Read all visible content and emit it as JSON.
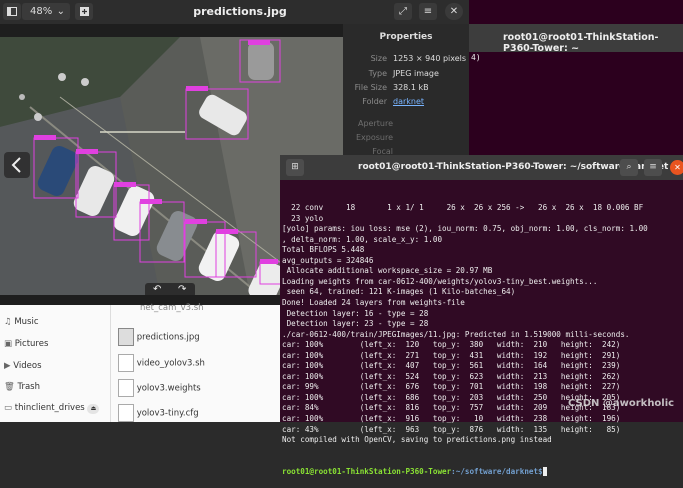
{
  "viewer": {
    "zoom": "48%",
    "title": "predictions.jpg",
    "properties": {
      "heading": "Properties",
      "size_label": "Size",
      "size_value": "1253 × 940 pixels",
      "type_label": "Type",
      "type_value": "JPEG image",
      "filesize_label": "File Size",
      "filesize_value": "328.1 kB",
      "folder_label": "Folder",
      "folder_value": "darknet",
      "aperture_label": "Aperture",
      "exposure_label": "Exposure",
      "focal_label": "Focal Length"
    },
    "detection_label": "car: 100%"
  },
  "bg_terminal": {
    "title": "root01@root01-ThinkStation-P360-Tower: ~",
    "fragment": "4)"
  },
  "files": {
    "sidebar": [
      {
        "label": "Music",
        "icon": "music-icon"
      },
      {
        "label": "Pictures",
        "icon": "pictures-icon"
      },
      {
        "label": "Videos",
        "icon": "videos-icon"
      },
      {
        "label": "Trash",
        "icon": "trash-icon"
      },
      {
        "label": "thinclient_drives",
        "icon": "drive-icon"
      }
    ],
    "items": [
      {
        "label": "net_cam_v3.sh"
      },
      {
        "label": "predictions.jpg"
      },
      {
        "label": "video_yolov3.sh"
      },
      {
        "label": "yolov3.weights"
      },
      {
        "label": "yolov3-tiny.cfg"
      }
    ]
  },
  "terminal": {
    "title": "root01@root01-ThinkStation-P360-Tower: ~/software/darknet",
    "lines": [
      "  22 conv     18       1 x 1/ 1     26 x  26 x 256 ->   26 x  26 x  18 0.006 BF",
      "  23 yolo",
      "[yolo] params: iou loss: mse (2), iou_norm: 0.75, obj_norm: 1.00, cls_norm: 1.00",
      ", delta_norm: 1.00, scale_x_y: 1.00",
      "Total BFLOPS 5.448",
      "avg_outputs = 324846",
      " Allocate additional workspace_size = 20.97 MB",
      "Loading weights from car-0612-400/weights/yolov3-tiny_best.weights...",
      " seen 64, trained: 121 K-images (1 Kilo-batches_64)",
      "Done! Loaded 24 layers from weights-file",
      " Detection layer: 16 - type = 28",
      " Detection layer: 23 - type = 28",
      "./car-0612-400/train/JPEGImages/11.jpg: Predicted in 1.519000 milli-seconds.",
      "car: 100%        (left_x:  120   top_y:  380   width:  210   height:  242)",
      "car: 100%        (left_x:  271   top_y:  431   width:  192   height:  291)",
      "car: 100%        (left_x:  407   top_y:  561   width:  164   height:  239)",
      "car: 100%        (left_x:  524   top_y:  623   width:  213   height:  262)",
      "car: 99%         (left_x:  676   top_y:  701   width:  198   height:  227)",
      "car: 100%        (left_x:  686   top_y:  203   width:  250   height:  205)",
      "car: 84%         (left_x:  816   top_y:  757   width:  209   height:  183)",
      "car: 100%        (left_x:  916   top_y:   10   width:  238   height:  196)",
      "car: 43%         (left_x:  963   top_y:  876   width:  135   height:   85)",
      "Not compiled with OpenCV, saving to predictions.png instead"
    ],
    "prompt_user": "root01@root01-ThinkStation-P360-Tower",
    "prompt_path": ":~/software/darknet$"
  },
  "watermark": "CSDN @aworkholic",
  "colors": {
    "terminal_bg": "#300a24",
    "bbox": "#e040e0",
    "prompt_user": "#8ae234",
    "prompt_path": "#729fcf"
  }
}
